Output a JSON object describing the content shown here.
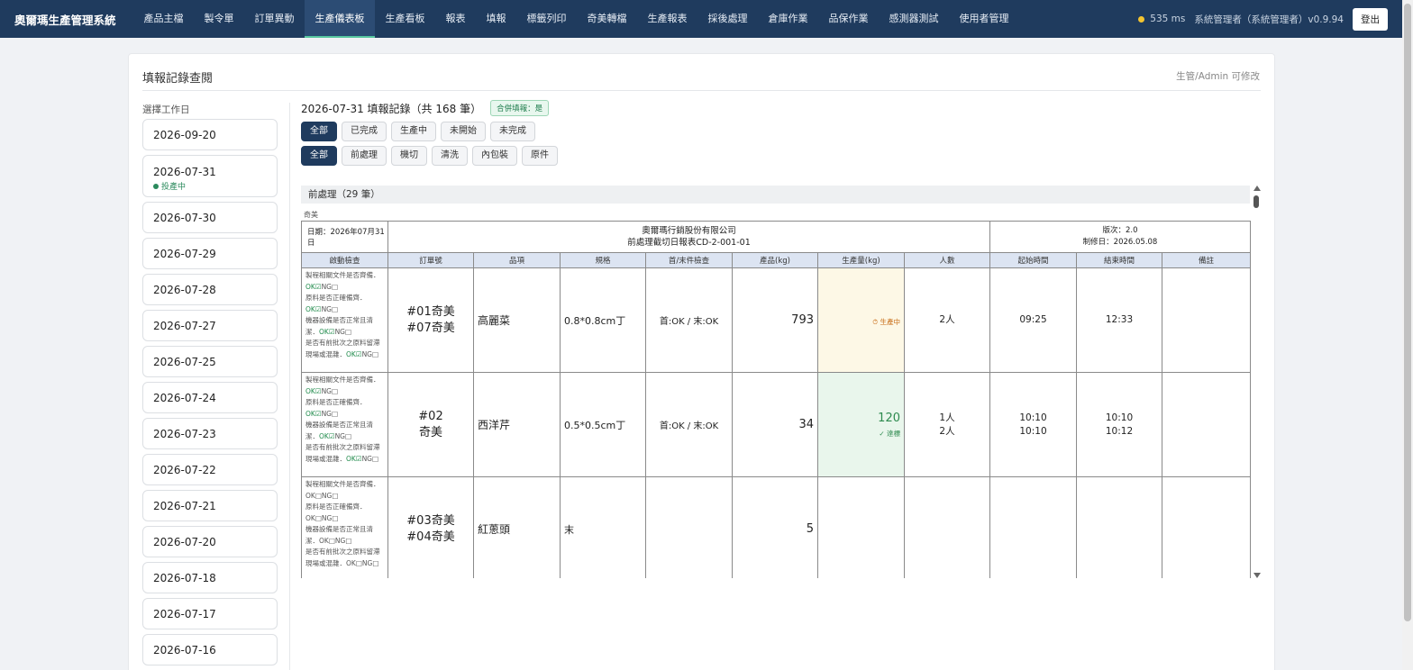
{
  "app": {
    "brand": "奧爾瑪生產管理系統",
    "nav": [
      "產品主檔",
      "製令單",
      "訂單異動",
      "生產儀表板",
      "生產看板",
      "報表",
      "填報",
      "標籤列印",
      "奇美轉檔",
      "生產報表",
      "採後處理",
      "倉庫作業",
      "品保作業",
      "感測器測試",
      "使用者管理"
    ],
    "active_nav": "生產儀表板",
    "latency": "535 ms",
    "user": "系統管理者（系統管理者）v0.9.94",
    "logout": "登出"
  },
  "page": {
    "title": "填報記錄查閱",
    "note": "生管/Admin 可修改",
    "date_label": "選擇工作日",
    "dates": [
      {
        "date": "2026-09-20"
      },
      {
        "date": "2026-07-31",
        "sub": "投產中"
      },
      {
        "date": "2026-07-30"
      },
      {
        "date": "2026-07-29"
      },
      {
        "date": "2026-07-28"
      },
      {
        "date": "2026-07-27"
      },
      {
        "date": "2026-07-25"
      },
      {
        "date": "2026-07-24"
      },
      {
        "date": "2026-07-23"
      },
      {
        "date": "2026-07-22"
      },
      {
        "date": "2026-07-21"
      },
      {
        "date": "2026-07-20"
      },
      {
        "date": "2026-07-18"
      },
      {
        "date": "2026-07-17"
      },
      {
        "date": "2026-07-16"
      }
    ],
    "records_heading": "2026-07-31 填報記錄（共 168 筆）",
    "merge_badge": "合併填報：是",
    "status_filters": [
      "全部",
      "已完成",
      "生產中",
      "未開始",
      "未完成"
    ],
    "process_filters": [
      "全部",
      "前處理",
      "機切",
      "清洗",
      "內包裝",
      "原件"
    ],
    "group_header": "前處理（29 筆）",
    "customer_label": "奇美"
  },
  "form": {
    "date": "日期：2026年07月31日",
    "company": "奧爾瑪行銷股份有限公司",
    "form_name": "前處理截切日報表CD-2-001-01",
    "version": "版次：2.0",
    "revised": "制修日：2026.05.08",
    "columns": [
      "啟動檢查",
      "訂單號",
      "品項",
      "規格",
      "首/末件檢查",
      "產品(kg)",
      "生產量(kg)",
      "人數",
      "起始時間",
      "結束時間",
      "備註"
    ],
    "check_items": [
      "製程相關文件是否齊備．",
      "原料是否正確備齊．",
      "機器設備是否正常且清潔．",
      "是否有前批次之原料留滯現場或混雜．"
    ],
    "rows": [
      {
        "check_state": "checked",
        "order_lines": [
          "#01奇美",
          "#07奇美"
        ],
        "item": "高麗菜",
        "spec": "0.8*0.8cm丁",
        "inspection": "首:OK / 末:OK",
        "qty": "793",
        "production": "",
        "prod_status": "⏱ 生產中",
        "prod_state": "warn",
        "people_lines": [
          "2人"
        ],
        "start_lines": [
          "09:25"
        ],
        "end_lines": [
          "12:33"
        ],
        "note": ""
      },
      {
        "check_state": "checked",
        "order_lines": [
          "#02",
          "奇美"
        ],
        "item": "西洋芹",
        "spec": "0.5*0.5cm丁",
        "inspection": "首:OK / 末:OK",
        "qty": "34",
        "production": "120",
        "prod_status": "✓ 達標",
        "prod_state": "done",
        "people_lines": [
          "1人",
          "2人"
        ],
        "start_lines": [
          "10:10",
          "10:10"
        ],
        "end_lines": [
          "10:10",
          "10:12"
        ],
        "note": ""
      },
      {
        "check_state": "empty",
        "order_lines": [
          "#03奇美",
          "#04奇美"
        ],
        "item": "紅蔥頭",
        "spec": "末",
        "inspection": "",
        "qty": "5",
        "production": "",
        "prod_status": "",
        "prod_state": "none",
        "people_lines": [],
        "start_lines": [],
        "end_lines": [],
        "note": ""
      }
    ],
    "ok_label": "OK",
    "ng_label": "NG"
  },
  "colors": {
    "nav_bg": "#1f3b5e",
    "accent": "#57c7a0",
    "ok": "#1e8a4a",
    "warn": "#c76a12"
  }
}
